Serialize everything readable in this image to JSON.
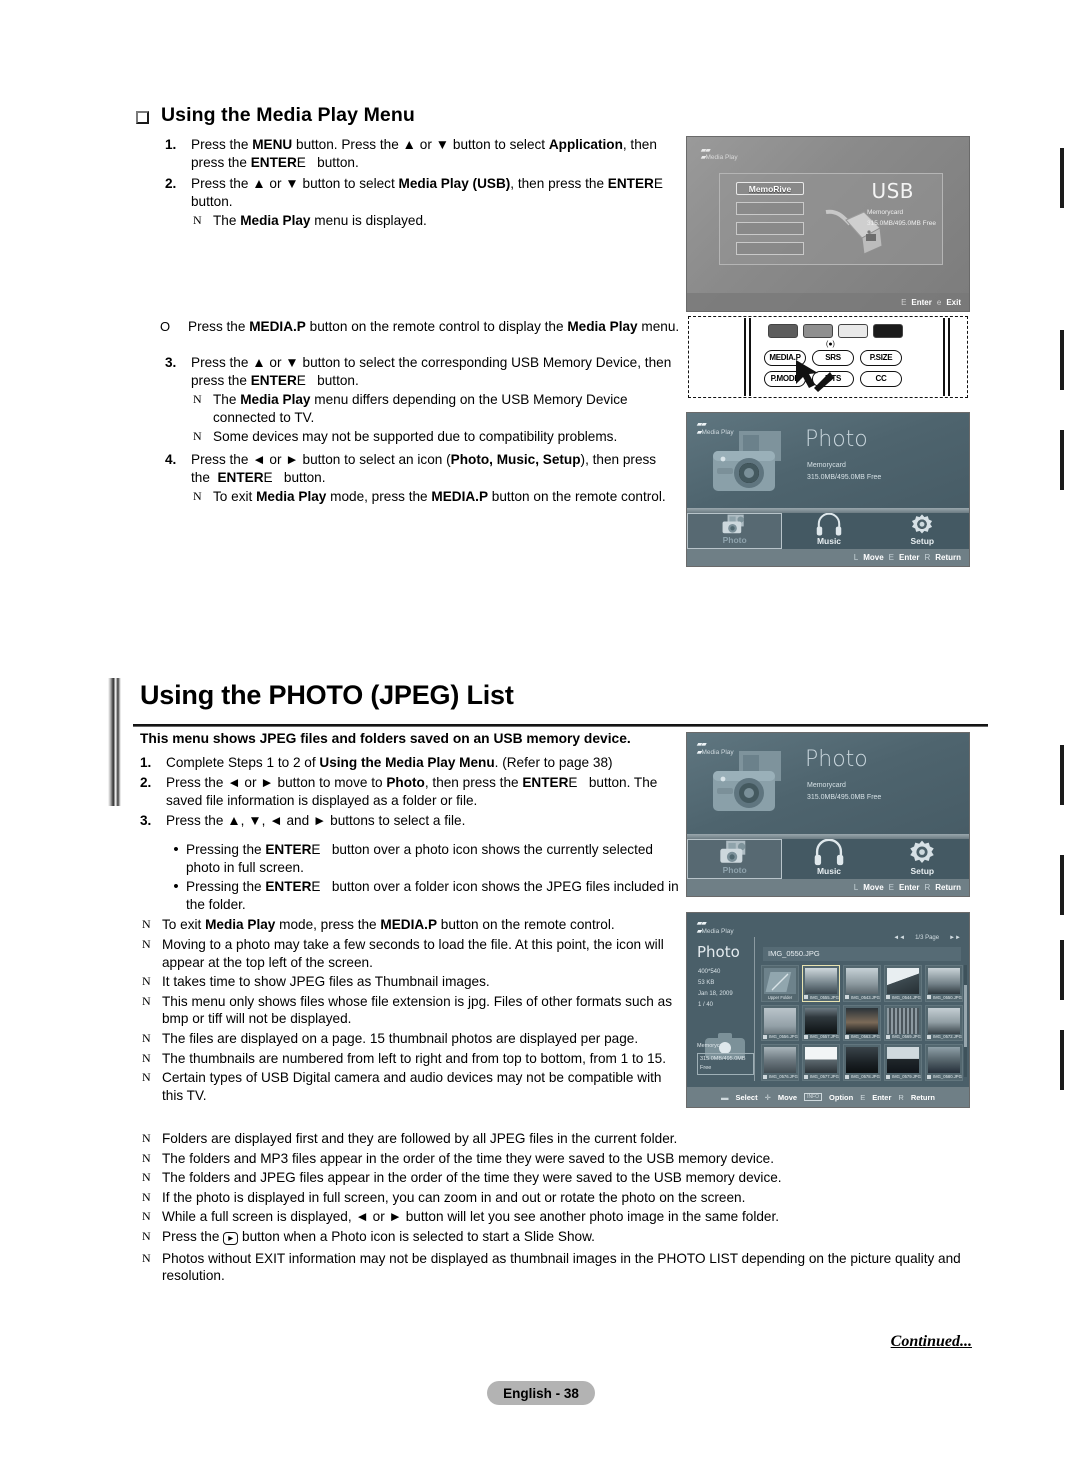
{
  "document": {
    "page_badge": "English - 38",
    "continued": "Continued..."
  },
  "section1": {
    "heading": "Using the Media Play Menu",
    "steps": [
      {
        "n": "1.",
        "text": "Press the MENU button. Press the ▲ or ▼ button to select Application, then press the ENTERE   button."
      },
      {
        "n": "2.",
        "text": "Press the ▲ or ▼ button to select Media Play (USB), then press the ENTERE button."
      }
    ],
    "note_after_step2": "The Media Play menu is displayed.",
    "o_note": "Press the MEDIA.P button on the remote control to display the Media Play menu.",
    "step3": {
      "n": "3.",
      "text": "Press the ▲ or ▼ button to select the corresponding USB Memory Device, then press the ENTERE   button."
    },
    "step3_notes": [
      "The Media Play menu differs depending on the USB Memory Device connected to TV.",
      "Some devices may not be supported due to compatibility problems."
    ],
    "step4": {
      "n": "4.",
      "text": "Press the ◄ or ► button to select an icon (Photo, Music, Setup), then press the  ENTERE   button."
    },
    "step4_notes": [
      "To exit Media Play mode, press the MEDIA.P button on the remote control."
    ]
  },
  "section2": {
    "heading": "Using the PHOTO (JPEG) List",
    "intro": "This menu shows JPEG files and folders saved on an USB memory device.",
    "steps": [
      {
        "n": "1.",
        "text": "Complete Steps 1 to 2 of Using the Media Play Menu. (Refer to page 38)"
      },
      {
        "n": "2.",
        "text": "Press the ◄ or ► button to move to Photo, then press the ENTERE   button. The saved file information is displayed as a folder or file."
      },
      {
        "n": "3.",
        "text": "Press the ▲, ▼, ◄ and ► buttons to select a file."
      }
    ],
    "dot_notes": [
      "Pressing the ENTERE   button over a photo icon shows the currently selected photo in full screen.",
      "Pressing the ENTERE   button over a folder icon shows the JPEG files included in the folder."
    ],
    "notes": [
      "To exit Media Play mode, press the MEDIA.P button on the remote control.",
      "Moving to a photo may take a few seconds to load the file. At this point, the icon will appear at the top left of the screen.",
      "It takes time to show JPEG files as Thumbnail images.",
      "This menu only shows files whose file extension is jpg. Files of other formats such as bmp or tiff will not be displayed.",
      "The files are displayed on a page. 15 thumbnail photos are displayed per page.",
      "The thumbnails are numbered from left to right and from top to bottom, from 1 to 15.",
      "Certain types of USB Digital camera and audio devices may not be compatible with this TV.",
      "Folders are displayed first and they are followed by all JPEG files in the current folder.",
      "The folders and MP3 files appear in the order of the time they were saved to the USB memory device.",
      "The folders and JPEG files appear in the order of the time they were saved to the USB memory device.",
      "If the photo is displayed in full screen, you can zoom in and out or rotate the photo on the screen.",
      "While a full screen is displayed, ◄ or ► button will let you see another photo image in the same folder.",
      "Press the ⊡ button when a Photo icon is selected to start a Slide Show.",
      "Photos without EXIT information may not be displayed as thumbnail images in the PHOTO LIST depending on the picture quality and resolution."
    ]
  },
  "usb_screen": {
    "logo": "Media Play",
    "device_label": "MemoRive",
    "title": "USB",
    "card_label": "Memorycard",
    "capacity": "315.0MB/495.0MB Free",
    "footer": [
      {
        "key": "E",
        "label": "Enter"
      },
      {
        "key": "e",
        "label": "Exit"
      }
    ]
  },
  "remote": {
    "buttons": [
      "MEDIA.P",
      "SRS",
      "P.SIZE",
      "P.MODE",
      "MTS",
      "CC"
    ],
    "color_buttons": [
      "red",
      "green",
      "yellow",
      "blue"
    ],
    "rec_mark": "(●)"
  },
  "photo_menu": {
    "logo": "Media Play",
    "title": "Photo",
    "card_label": "Memorycard",
    "capacity": "315.0MB/495.0MB Free",
    "icons": [
      {
        "label": "Photo",
        "selected": true
      },
      {
        "label": "Music",
        "selected": false
      },
      {
        "label": "Setup",
        "selected": false
      }
    ],
    "footer": [
      {
        "key": "L",
        "label": "Move"
      },
      {
        "key": "E",
        "label": "Enter"
      },
      {
        "key": "R",
        "label": "Return"
      }
    ]
  },
  "thumb_screen": {
    "logo": "Media Play",
    "panel_title": "Photo",
    "panel_meta": [
      "400*540",
      "53 KB",
      "Jan 18, 2009",
      "1 / 40"
    ],
    "card_label": "Memorycard",
    "capacity": "315.0MB/495.0MB Free",
    "page_indicator": "1/3 Page",
    "page_prev": "◄◄",
    "page_next": "►►",
    "current_file": "IMG_0550.JPG",
    "cells": [
      {
        "label": "Upper Folder",
        "type": "folder",
        "selected": false
      },
      {
        "label": "IMG_0555.JPG",
        "type": "photo",
        "selected": true
      },
      {
        "label": "IMG_0543.JPG",
        "type": "photo",
        "selected": false
      },
      {
        "label": "IMG_0544.JPG",
        "type": "photo",
        "selected": false
      },
      {
        "label": "IMG_0550.JPG",
        "type": "photo",
        "selected": false
      },
      {
        "label": "IMG_0556.JPG",
        "type": "photo",
        "selected": false
      },
      {
        "label": "IMG_0557.JPG",
        "type": "photo",
        "selected": false
      },
      {
        "label": "IMG_0563.JPG",
        "type": "photo",
        "selected": false
      },
      {
        "label": "IMG_0569.JPG",
        "type": "photo",
        "selected": false
      },
      {
        "label": "IMG_0572.JPG",
        "type": "photo",
        "selected": false
      },
      {
        "label": "IMG_0576.JPG",
        "type": "photo",
        "selected": false
      },
      {
        "label": "IMG_0577.JPG",
        "type": "photo",
        "selected": false
      },
      {
        "label": "IMG_0578.JPG",
        "type": "photo",
        "selected": false
      },
      {
        "label": "IMG_0579.JPG",
        "type": "photo",
        "selected": false
      },
      {
        "label": "IMG_0580.JPG",
        "type": "photo",
        "selected": false
      }
    ],
    "footer": [
      {
        "key": "▬",
        "label": "Select"
      },
      {
        "key": "✛",
        "label": "Move"
      },
      {
        "key": "INFO",
        "label": "Option"
      },
      {
        "key": "E",
        "label": "Enter"
      },
      {
        "key": "R",
        "label": "Return"
      }
    ]
  }
}
